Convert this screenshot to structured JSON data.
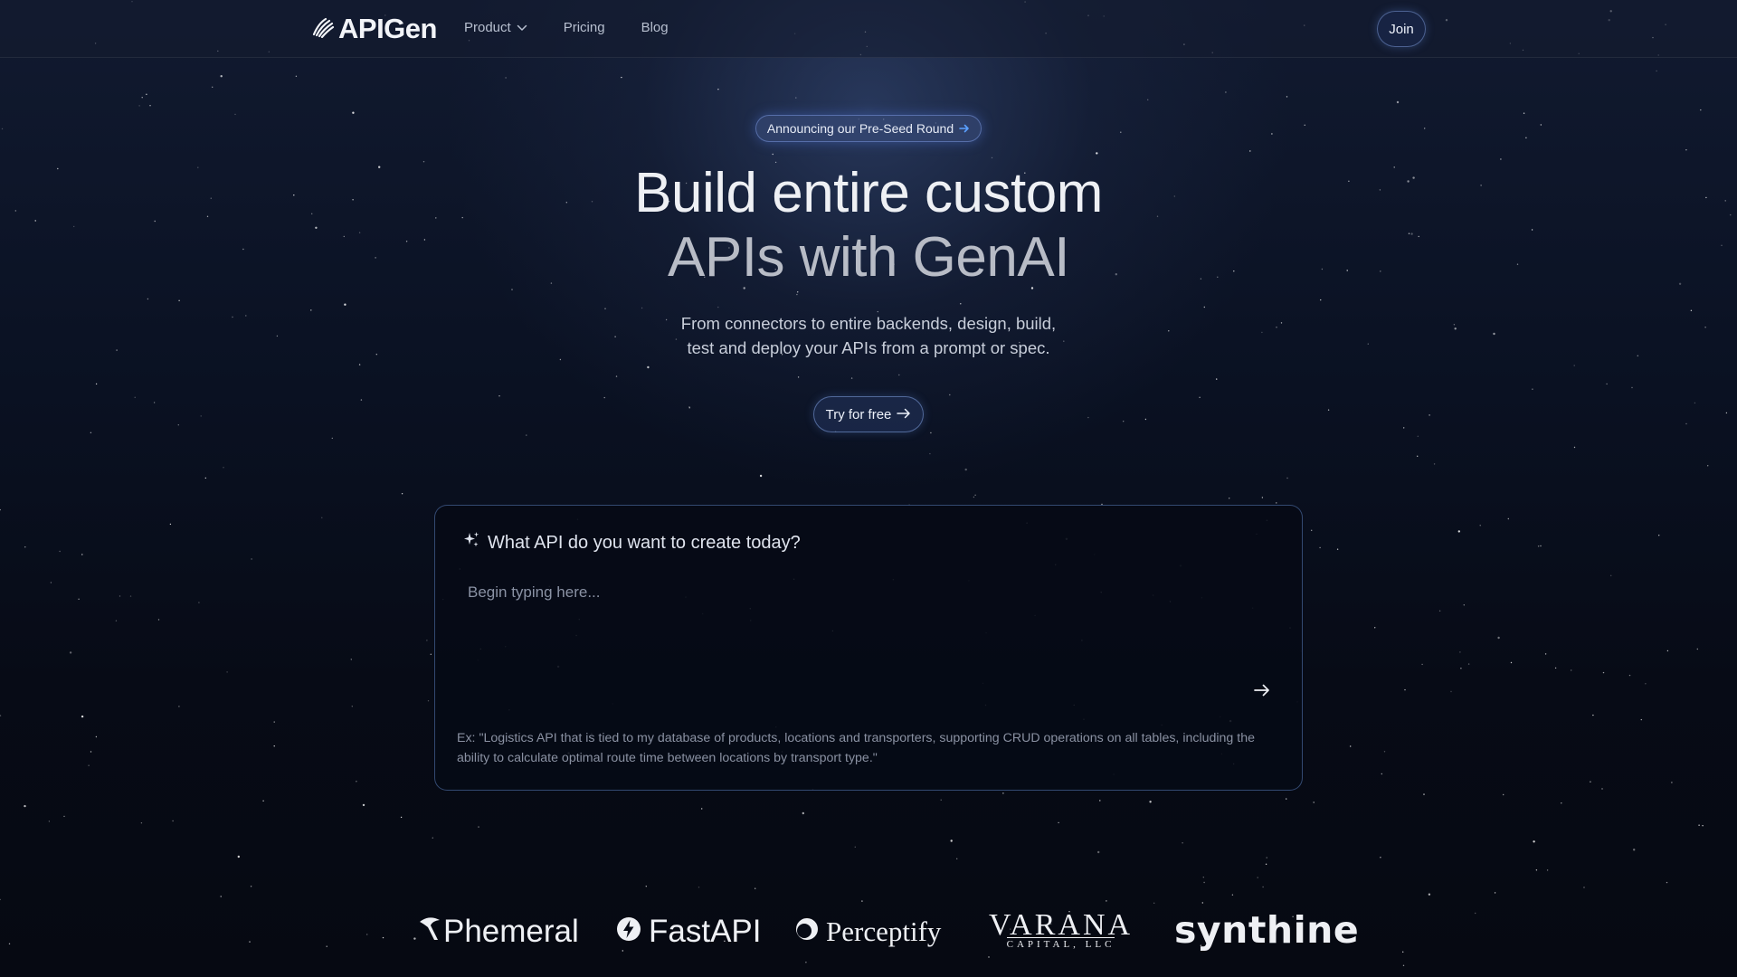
{
  "nav": {
    "brand": "APIGen",
    "links": [
      {
        "label": "Product",
        "has_dropdown": true
      },
      {
        "label": "Pricing"
      },
      {
        "label": "Blog"
      }
    ],
    "join_label": "Join"
  },
  "hero": {
    "announcement": "Announcing our Pre-Seed Round",
    "headline_line1": "Build entire custom",
    "headline_line2": "APIs with GenAI",
    "subtitle_line1": "From connectors to entire backends, design, build,",
    "subtitle_line2": "test and deploy your APIs from a prompt or spec.",
    "cta_label": "Try for free"
  },
  "prompt_card": {
    "title": "What API do you want to create today?",
    "input_value": "",
    "input_placeholder": "Begin typing here...",
    "example": "Ex: \"Logistics API that is tied to my database of products, locations and transporters, supporting CRUD operations on all tables, including the ability to calculate optimal route time between locations by transport type.\""
  },
  "logos": {
    "phemeral": "Phemeral",
    "fastapi": "FastAPI",
    "perceptify": "Perceptify",
    "varana_main": "VARANA",
    "varana_sub": "CAPITAL, LLC",
    "synthine": "synthine"
  },
  "icons": {
    "brand": "wave-lines-icon",
    "dropdown": "chevron-down-icon",
    "announcement_arrow": "arrow-right-icon",
    "cta_arrow": "arrow-right-icon",
    "sparkle": "sparkle-icon",
    "send": "arrow-right-icon"
  },
  "colors": {
    "background": "#070b16",
    "accent": "#5aa0ff",
    "text": "#eef0f4",
    "muted": "#8a91a2"
  }
}
